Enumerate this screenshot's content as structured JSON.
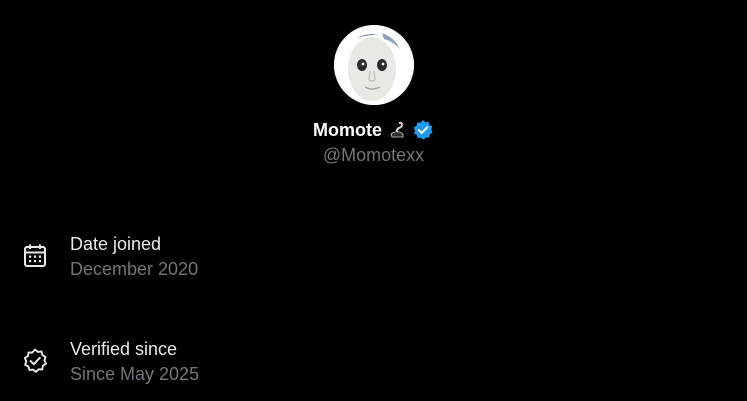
{
  "profile": {
    "display_name": "Momote",
    "emoji_icon": "black-swan-emoji-icon",
    "verified_icon": "verified-badge-icon",
    "handle": "@Momotexx",
    "avatar_icon": "white-face-mask-avatar"
  },
  "details": {
    "date_joined": {
      "icon": "calendar-icon",
      "label": "Date joined",
      "value": "December 2020"
    },
    "verified_since": {
      "icon": "verified-check-icon",
      "label": "Verified since",
      "value": "Since May 2025"
    }
  },
  "colors": {
    "background": "#000000",
    "primary_text": "#e7e9ea",
    "secondary_text": "#71767b",
    "verified_blue": "#1d9bf0"
  }
}
